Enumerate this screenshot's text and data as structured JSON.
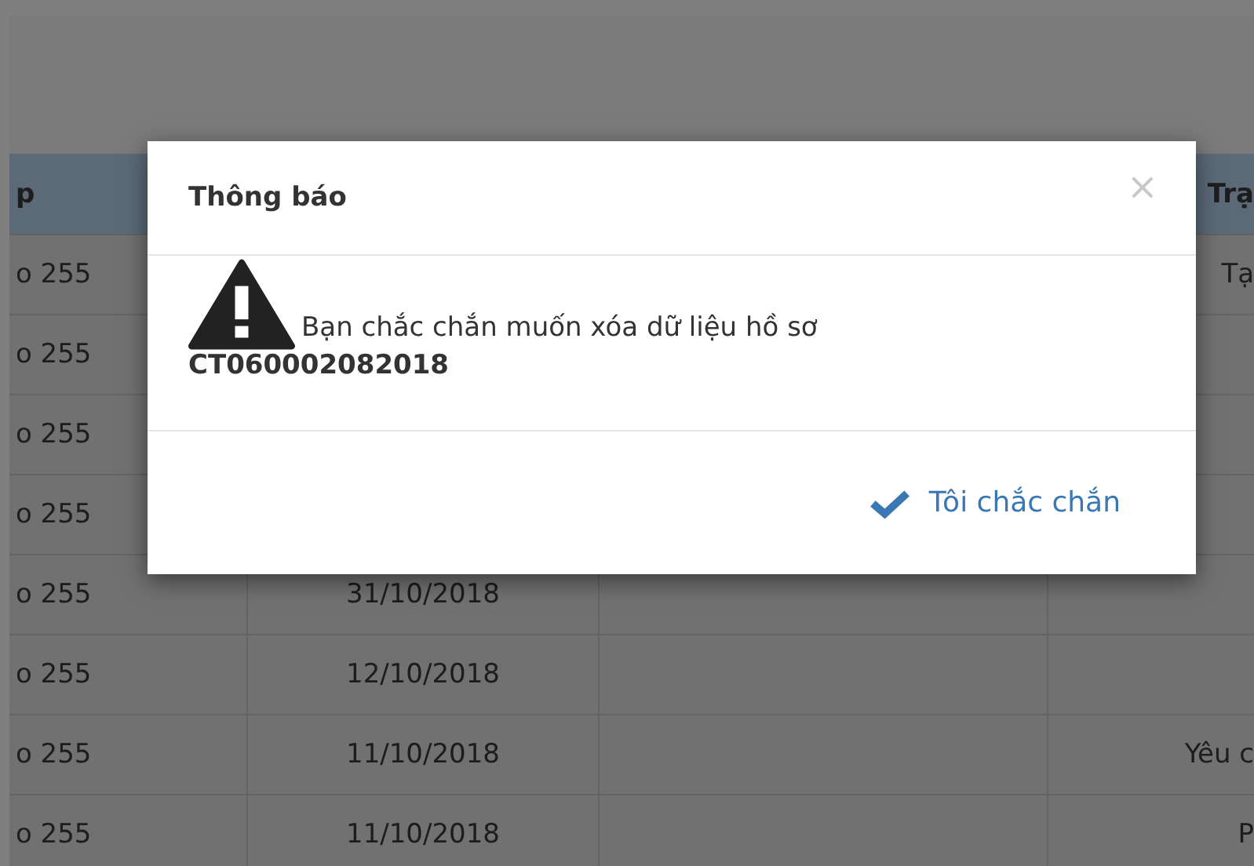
{
  "table": {
    "header": {
      "column_1": "p",
      "column_4": "Trạ"
    },
    "rows": [
      {
        "column_1": "o 255",
        "column_4": "Tạ"
      },
      {
        "column_1": "o 255"
      },
      {
        "column_1": "o 255"
      },
      {
        "column_1": "o 255"
      },
      {
        "column_1": "o 255",
        "column_2": "31/10/2018"
      },
      {
        "column_1": "o 255",
        "column_2": "12/10/2018"
      },
      {
        "column_1": "o 255",
        "column_2": "11/10/2018",
        "column_4": "Yêu c"
      },
      {
        "column_1": "o 255",
        "column_2": "11/10/2018",
        "column_4": "P"
      }
    ]
  },
  "dialog": {
    "title": "Thông báo",
    "close": "×",
    "message": "Bạn chắc chắn muốn xóa dữ liệu hồ sơ",
    "record_code": "CT060002082018",
    "confirm_button": "Tôi chắc chắn"
  }
}
